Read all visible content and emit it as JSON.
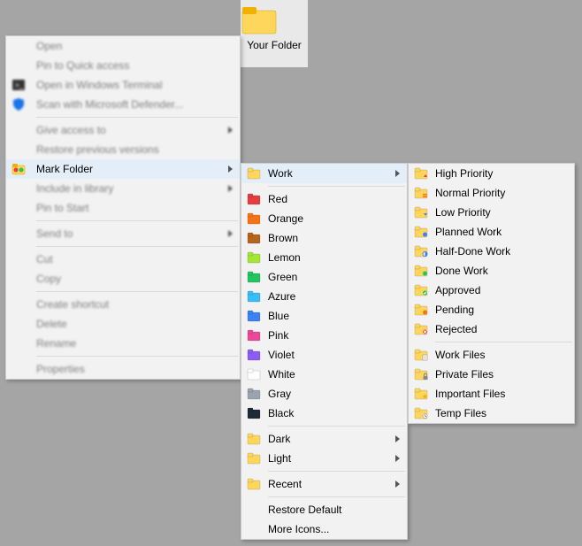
{
  "desktop": {
    "folder_label": "Your Folder"
  },
  "menu1": {
    "open": "Open",
    "pin_quick": "Pin to Quick access",
    "open_terminal": "Open in Windows Terminal",
    "scan_defender": "Scan with Microsoft Defender...",
    "give_access": "Give access to",
    "restore_prev": "Restore previous versions",
    "mark_folder": "Mark Folder",
    "include_library": "Include in library",
    "pin_start": "Pin to Start",
    "send_to": "Send to",
    "cut": "Cut",
    "copy": "Copy",
    "create_shortcut": "Create shortcut",
    "delete": "Delete",
    "rename": "Rename",
    "properties": "Properties"
  },
  "menu2": {
    "work": "Work",
    "colors": {
      "red": "Red",
      "orange": "Orange",
      "brown": "Brown",
      "lemon": "Lemon",
      "green": "Green",
      "azure": "Azure",
      "blue": "Blue",
      "pink": "Pink",
      "violet": "Violet",
      "white": "White",
      "gray": "Gray",
      "black": "Black"
    },
    "dark": "Dark",
    "light": "Light",
    "recent": "Recent",
    "restore_default": "Restore Default",
    "more_icons": "More Icons..."
  },
  "menu3": {
    "priority": {
      "high": "High Priority",
      "normal": "Normal Priority",
      "low": "Low Priority"
    },
    "work": {
      "planned": "Planned Work",
      "half": "Half-Done Work",
      "done": "Done Work"
    },
    "status": {
      "approved": "Approved",
      "pending": "Pending",
      "rejected": "Rejected"
    },
    "files": {
      "work": "Work Files",
      "private": "Private Files",
      "important": "Important Files",
      "temp": "Temp Files"
    }
  },
  "color_hex": {
    "red": "#e53e3e",
    "orange": "#f97316",
    "brown": "#b5651d",
    "lemon": "#a3e635",
    "green": "#22c55e",
    "azure": "#38bdf8",
    "blue": "#3b82f6",
    "pink": "#ec4899",
    "violet": "#8b5cf6",
    "white": "#ffffff",
    "gray": "#9ca3af",
    "black": "#1f2937",
    "yellow": "#ffd65c"
  }
}
